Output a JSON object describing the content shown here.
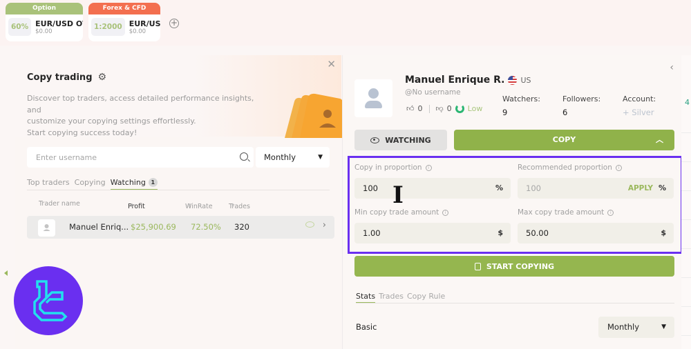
{
  "asset_tabs": [
    {
      "category": "Option",
      "category_color": "#a9c27a",
      "rate": "60%",
      "pair": "EUR/USD OTC",
      "amount": "$0.00"
    },
    {
      "category": "Forex & CFD",
      "category_color": "#f36f4f",
      "rate": "1:2000",
      "pair": "EUR/USD",
      "amount": "$0.00"
    }
  ],
  "copy_trading": {
    "title": "Copy trading",
    "description": [
      "Discover top traders, access detailed performance insights, and",
      "customize your copying settings effortlessly.",
      "Start copying success today!"
    ],
    "search_placeholder": "Enter username",
    "period": "Monthly",
    "tabs": [
      {
        "label": "Top traders",
        "active": false
      },
      {
        "label": "Copying",
        "active": false
      },
      {
        "label": "Watching",
        "active": true,
        "badge": "1"
      }
    ],
    "columns": [
      "Trader name",
      "Profit",
      "WinRate",
      "Trades"
    ],
    "rows": [
      {
        "name": "Manuel Enriq...",
        "profit": "$25,900.69",
        "winrate": "72.50%",
        "trades": "320"
      }
    ]
  },
  "profile": {
    "name": "Manuel Enrique R.",
    "country": "US",
    "username": "@No username",
    "likes": "0",
    "dislikes": "0",
    "risk": "Low",
    "stats": [
      {
        "label": "Watchers:",
        "value": "9"
      },
      {
        "label": "Followers:",
        "value": "6"
      },
      {
        "label": "Account:",
        "value": "+ Silver"
      }
    ],
    "watching_label": "WATCHING",
    "copy_label": "COPY",
    "settings": {
      "copy_in_proportion": {
        "label": "Copy in proportion",
        "value": "100",
        "unit": "%"
      },
      "recommended_proportion": {
        "label": "Recommended proportion",
        "value": "100",
        "apply": "APPLY",
        "unit": "%"
      },
      "min_amount": {
        "label": "Min copy trade amount",
        "value": "1.00",
        "unit": "$"
      },
      "max_amount": {
        "label": "Max copy trade amount",
        "value": "50.00",
        "unit": "$"
      }
    },
    "start_label": "START COPYING",
    "tabs": [
      {
        "label": "Stats",
        "active": true
      },
      {
        "label": "Trades",
        "active": false
      },
      {
        "label": "Copy Rule",
        "active": false
      }
    ],
    "section": "Basic",
    "period": "Monthly"
  },
  "edge_value": "4",
  "colors": {
    "accent_green": "#90b24a",
    "highlight_purple": "#6a2ff0",
    "option_tab": "#a9c27a",
    "forex_tab": "#f36f4f"
  }
}
